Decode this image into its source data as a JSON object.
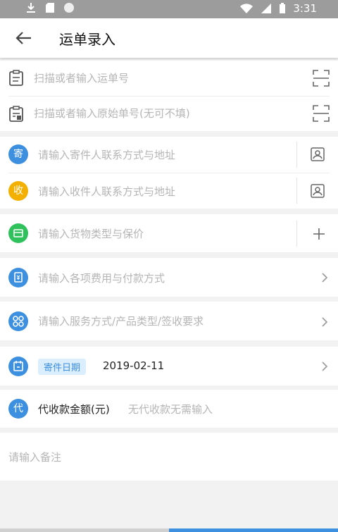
{
  "status_bar": {
    "time": "3:31",
    "icons": [
      "download-icon",
      "sd-card-icon",
      "circle-icon",
      "wifi-icon",
      "signal-icon",
      "battery-icon"
    ]
  },
  "header": {
    "title": "运单录入",
    "back_icon": "back-arrow-icon"
  },
  "waybill": {
    "waybill_placeholder": "扫描或者输入运单号",
    "original_placeholder": "扫描或者输入原始单号(无可不填)"
  },
  "parties": {
    "sender_badge": "寄",
    "sender_placeholder": "请输入寄件人联系方式与地址",
    "receiver_badge": "收",
    "receiver_placeholder": "请输入收件人联系方式与地址"
  },
  "goods": {
    "placeholder": "请输入货物类型与保价"
  },
  "fees": {
    "placeholder": "请输入各项费用与付款方式"
  },
  "service": {
    "placeholder": "请输入服务方式/产品类型/签收要求"
  },
  "date": {
    "badge": "寄件日期",
    "value": "2019-02-11"
  },
  "cod": {
    "badge": "代",
    "label": "代收款金额(元)",
    "placeholder": "无代收款无需输入"
  },
  "remark": {
    "placeholder": "请输入备注"
  },
  "colors": {
    "accent": "#3d8fe0",
    "yellow": "#f4b000",
    "green": "#2fc15c",
    "placeholder": "#b5b5b5"
  }
}
